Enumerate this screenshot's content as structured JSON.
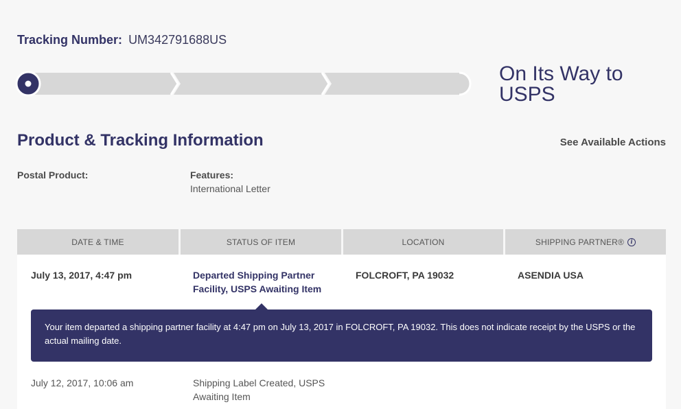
{
  "tracking": {
    "label": "Tracking Number:",
    "number": "UM342791688US"
  },
  "progress": {
    "steps_total": 3,
    "current_step": 0
  },
  "status_heading": "On Its Way to USPS",
  "section": {
    "title": "Product & Tracking Information",
    "actions_link": "See Available Actions"
  },
  "product": {
    "postal_product_label": "Postal Product:",
    "features_label": "Features:",
    "features_value": "International Letter"
  },
  "table": {
    "headers": [
      "DATE & TIME",
      "STATUS OF ITEM",
      "LOCATION",
      "SHIPPING PARTNER®"
    ],
    "rows": [
      {
        "date": "July 13, 2017, 4:47 pm",
        "status": "Departed Shipping Partner Facility, USPS Awaiting Item",
        "location": "FOLCROFT, PA 19032",
        "partner": "ASENDIA USA",
        "detail": "Your item departed a shipping partner facility at 4:47 pm on July 13, 2017 in FOLCROFT, PA 19032. This does not indicate receipt by the USPS or the actual mailing date."
      },
      {
        "date": "July 12, 2017, 10:06 am",
        "status": "Shipping Label Created, USPS Awaiting Item",
        "location": "",
        "partner": ""
      }
    ]
  },
  "colors": {
    "brand_navy": "#333366",
    "progress_track": "#d7d7d7",
    "background": "#f7f7f7"
  },
  "icons": {
    "info": "info-icon",
    "progress_marker": "progress-marker-icon"
  }
}
